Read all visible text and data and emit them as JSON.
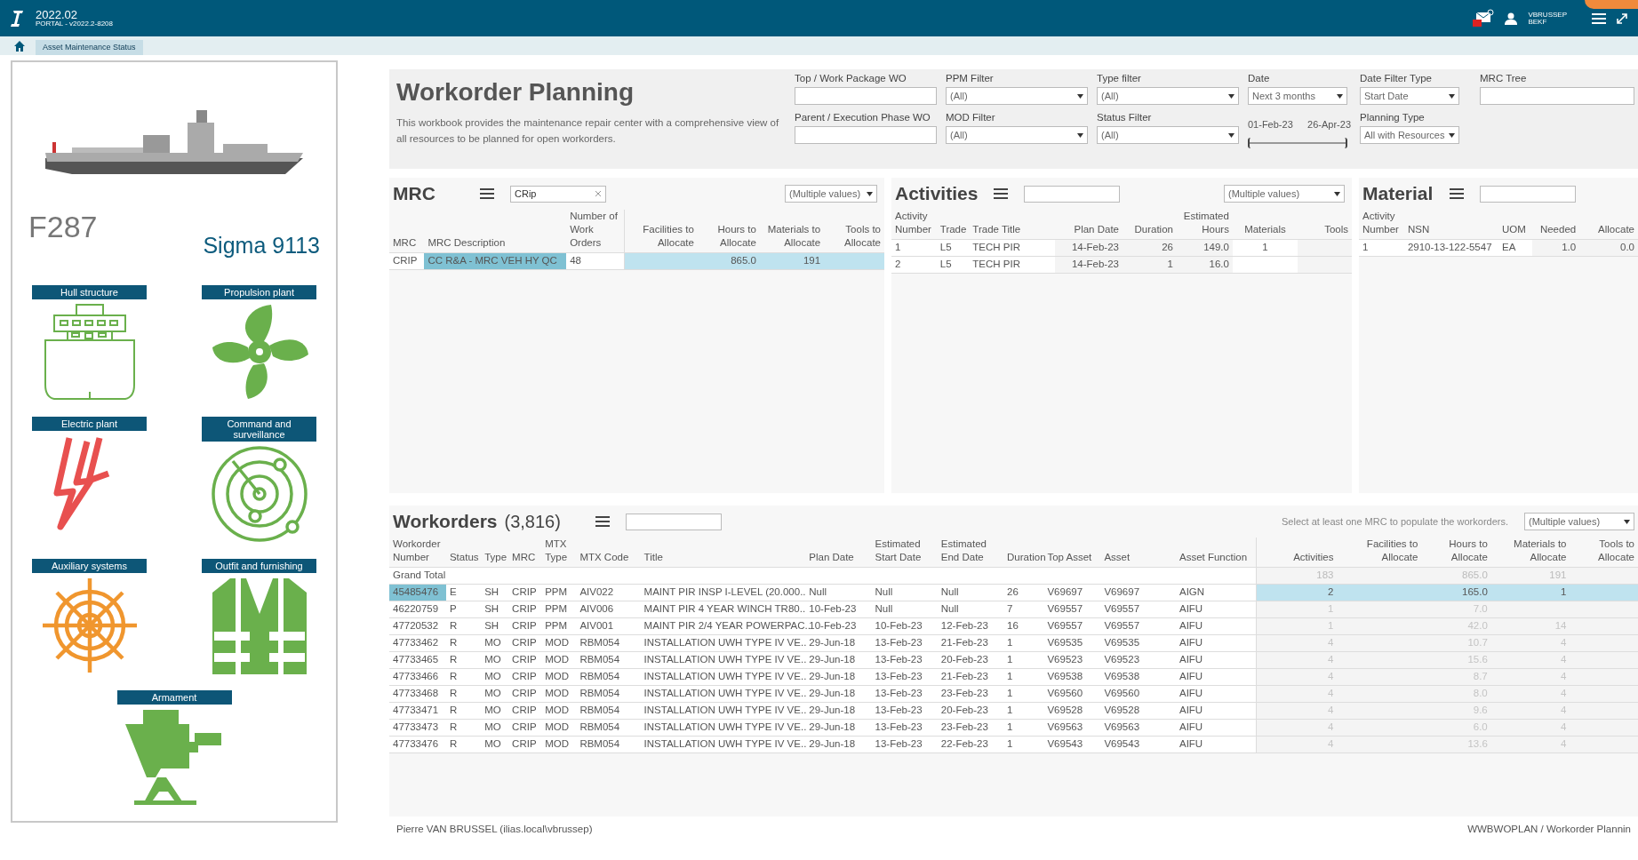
{
  "app": {
    "version": "2022.02",
    "build": "PORTAL - v2022.2-8208",
    "user": "VBRUSSEP",
    "user_unit": "BEKF"
  },
  "tabs": [
    {
      "label": "Asset Maintenance Status",
      "selected": true
    }
  ],
  "ship": {
    "hull_number": "F287",
    "class_name": "Sigma 9113"
  },
  "systems": [
    {
      "label": "Hull structure",
      "kind": "hull",
      "color": "#6ab04c"
    },
    {
      "label": "Propulsion plant",
      "kind": "propeller",
      "color": "#6ab04c"
    },
    {
      "label": "Electric plant",
      "kind": "lightning",
      "color": "#e8504f"
    },
    {
      "label": "Command and surveillance",
      "kind": "radar",
      "color": "#6ab04c"
    },
    {
      "label": "Auxiliary systems",
      "kind": "wheel",
      "color": "#f0962e"
    },
    {
      "label": "Outfit and furnishing",
      "kind": "vest",
      "color": "#6ab04c"
    },
    {
      "label": "Armament",
      "kind": "gun",
      "color": "#6ab04c"
    }
  ],
  "header": {
    "title": "Workorder Planning",
    "description": "This workbook provides the maintenance repair center with a comprehensive view of all resources to be planned for open workorders."
  },
  "filters": [
    [
      {
        "kind": "text",
        "label": "Top / Work Package WO"
      },
      {
        "kind": "text",
        "label": "Parent / Execution Phase WO"
      }
    ],
    [
      {
        "kind": "dropdown",
        "label": "PPM Filter",
        "value": "(All)"
      },
      {
        "kind": "dropdown",
        "label": "MOD Filter",
        "value": "(All)"
      }
    ],
    [
      {
        "kind": "dropdown",
        "label": "Type filter",
        "value": "(All)"
      },
      {
        "kind": "dropdown",
        "label": "Status Filter",
        "value": "(All)"
      }
    ],
    [
      {
        "kind": "dropdown",
        "label": "Date",
        "value": "Next 3 months"
      },
      {
        "kind": "range",
        "start": "01-Feb-23",
        "end": "26-Apr-23",
        "level": 1
      }
    ],
    [
      {
        "kind": "dropdown",
        "label": "Date Filter Type",
        "value": "Start Date"
      },
      {
        "kind": "dropdown",
        "label": "Planning Type",
        "value": "All with Resources"
      }
    ],
    [
      {
        "kind": "text",
        "label": "MRC Tree"
      }
    ]
  ],
  "mrc": {
    "title": "MRC",
    "search": "CRip",
    "dropdown": "(Multiple values)",
    "columns": [
      "MRC",
      "MRC Description",
      "Number of Work Orders"
    ],
    "measure_columns": [
      "Facilities to Allocate",
      "Hours to Allocate",
      "Materials to Allocate",
      "Tools to Allocate"
    ],
    "rows": [
      {
        "selected": true,
        "cells": [
          "CRIP",
          "CC R&A - MRC VEH HY QC",
          "48"
        ],
        "measures": {
          "hours": "865.0",
          "materials": "191"
        }
      }
    ]
  },
  "activities": {
    "title": "Activities",
    "dropdown": "(Multiple values)",
    "columns": [
      "Activity Number",
      "Trade",
      "Trade Title",
      "Plan Date",
      "Duration",
      "Estimated Hours",
      "Materials",
      "Tools"
    ],
    "rows": [
      {
        "number": "1",
        "trade": "L5",
        "trade_title": "TECH PIR",
        "plan_date": "14-Feb-23",
        "duration": "26",
        "hours": "149.0",
        "materials": "1"
      },
      {
        "number": "2",
        "trade": "L5",
        "trade_title": "TECH PIR",
        "plan_date": "14-Feb-23",
        "duration": "1",
        "hours": "16.0"
      }
    ]
  },
  "material": {
    "title": "Material",
    "columns": [
      "Activity Number",
      "NSN",
      "UOM",
      "Needed",
      "Allocate"
    ],
    "rows": [
      {
        "number": "1",
        "nsn": "2910-13-122-5547",
        "uom": "EA",
        "needed": "1.0",
        "allocated": "0.0"
      }
    ]
  },
  "workorders": {
    "title": "Workorders",
    "count": "(3,816)",
    "hint": "Select at least one MRC to populate the workorders.",
    "dropdown": "(Multiple values)",
    "columns": [
      "Workorder Number",
      "Status",
      "Type",
      "MRC",
      "MTX Type",
      "MTX Code",
      "Title",
      "Plan Date",
      "Estimated Start Date",
      "Estimated End Date",
      "Duration",
      "Top Asset",
      "Asset",
      "Asset Function"
    ],
    "measure_columns": [
      "Activities",
      "Facilities to Allocate",
      "Hours to Allocate",
      "Materials to Allocate",
      "Tools to Allocate"
    ],
    "grand_total": {
      "label": "Grand Total",
      "measures": {
        "activities": "183",
        "hours": "865.0",
        "materials": "191"
      }
    },
    "rows": [
      {
        "selected": true,
        "cells": [
          "45485476",
          "E",
          "SH",
          "CRIP",
          "PPM",
          "AIV022",
          "MAINT PIR INSP I-LEVEL (20.000..",
          "Null",
          "Null",
          "Null",
          "26",
          "V69697",
          "V69697",
          "AIGN"
        ],
        "measures": {
          "activities": "2",
          "hours": "165.0",
          "materials": "1"
        }
      },
      {
        "selected": false,
        "cells": [
          "46220759",
          "P",
          "SH",
          "CRIP",
          "PPM",
          "AIV006",
          "MAINT PIR 4 YEAR  WINCH TR80..",
          "10-Feb-23",
          "Null",
          "Null",
          "7",
          "V69557",
          "V69557",
          "AIFU"
        ],
        "measures": {
          "activities": "1",
          "hours": "7.0"
        }
      },
      {
        "selected": false,
        "cells": [
          "47720532",
          "R",
          "SH",
          "CRIP",
          "PPM",
          "AIV001",
          "MAINT PIR 2/4 YEAR POWERPAC..",
          "10-Feb-23",
          "10-Feb-23",
          "12-Feb-23",
          "16",
          "V69557",
          "V69557",
          "AIFU"
        ],
        "measures": {
          "activities": "1",
          "hours": "42.0",
          "materials": "14"
        }
      },
      {
        "selected": false,
        "cells": [
          "47733462",
          "R",
          "MO",
          "CRIP",
          "MOD",
          "RBM054",
          "INSTALLATION UWH TYPE IV  VE..",
          "29-Jun-18",
          "13-Feb-23",
          "21-Feb-23",
          "1",
          "V69535",
          "V69535",
          "AIFU"
        ],
        "measures": {
          "activities": "4",
          "hours": "10.7",
          "materials": "4"
        }
      },
      {
        "selected": false,
        "cells": [
          "47733465",
          "R",
          "MO",
          "CRIP",
          "MOD",
          "RBM054",
          "INSTALLATION UWH TYPE IV  VE..",
          "29-Jun-18",
          "13-Feb-23",
          "20-Feb-23",
          "1",
          "V69523",
          "V69523",
          "AIFU"
        ],
        "measures": {
          "activities": "4",
          "hours": "15.6",
          "materials": "4"
        }
      },
      {
        "selected": false,
        "cells": [
          "47733466",
          "R",
          "MO",
          "CRIP",
          "MOD",
          "RBM054",
          "INSTALLATION UWH TYPE IV  VE..",
          "29-Jun-18",
          "13-Feb-23",
          "21-Feb-23",
          "1",
          "V69538",
          "V69538",
          "AIFU"
        ],
        "measures": {
          "activities": "4",
          "hours": "8.7",
          "materials": "4"
        }
      },
      {
        "selected": false,
        "cells": [
          "47733468",
          "R",
          "MO",
          "CRIP",
          "MOD",
          "RBM054",
          "INSTALLATION UWH TYPE IV  VE..",
          "29-Jun-18",
          "13-Feb-23",
          "23-Feb-23",
          "1",
          "V69560",
          "V69560",
          "AIFU"
        ],
        "measures": {
          "activities": "4",
          "hours": "8.0",
          "materials": "4"
        }
      },
      {
        "selected": false,
        "cells": [
          "47733471",
          "R",
          "MO",
          "CRIP",
          "MOD",
          "RBM054",
          "INSTALLATION UWH TYPE IV  VE..",
          "29-Jun-18",
          "13-Feb-23",
          "20-Feb-23",
          "1",
          "V69528",
          "V69528",
          "AIFU"
        ],
        "measures": {
          "activities": "4",
          "hours": "9.6",
          "materials": "4"
        }
      },
      {
        "selected": false,
        "cells": [
          "47733473",
          "R",
          "MO",
          "CRIP",
          "MOD",
          "RBM054",
          "INSTALLATION UWH TYPE IV  VE..",
          "29-Jun-18",
          "13-Feb-23",
          "23-Feb-23",
          "1",
          "V69563",
          "V69563",
          "AIFU"
        ],
        "measures": {
          "activities": "4",
          "hours": "6.0",
          "materials": "4"
        }
      },
      {
        "selected": false,
        "cells": [
          "47733476",
          "R",
          "MO",
          "CRIP",
          "MOD",
          "RBM054",
          "INSTALLATION UWH TYPE IV  VE..",
          "29-Jun-18",
          "13-Feb-23",
          "22-Feb-23",
          "1",
          "V69543",
          "V69543",
          "AIFU"
        ],
        "measures": {
          "activities": "4",
          "hours": "13.6",
          "materials": "4"
        }
      }
    ]
  },
  "footer": {
    "user": "Pierre VAN BRUSSEL (ilias.local\\vbrussep)",
    "workbook": "WWBWOPLAN / Workorder Plannin"
  }
}
